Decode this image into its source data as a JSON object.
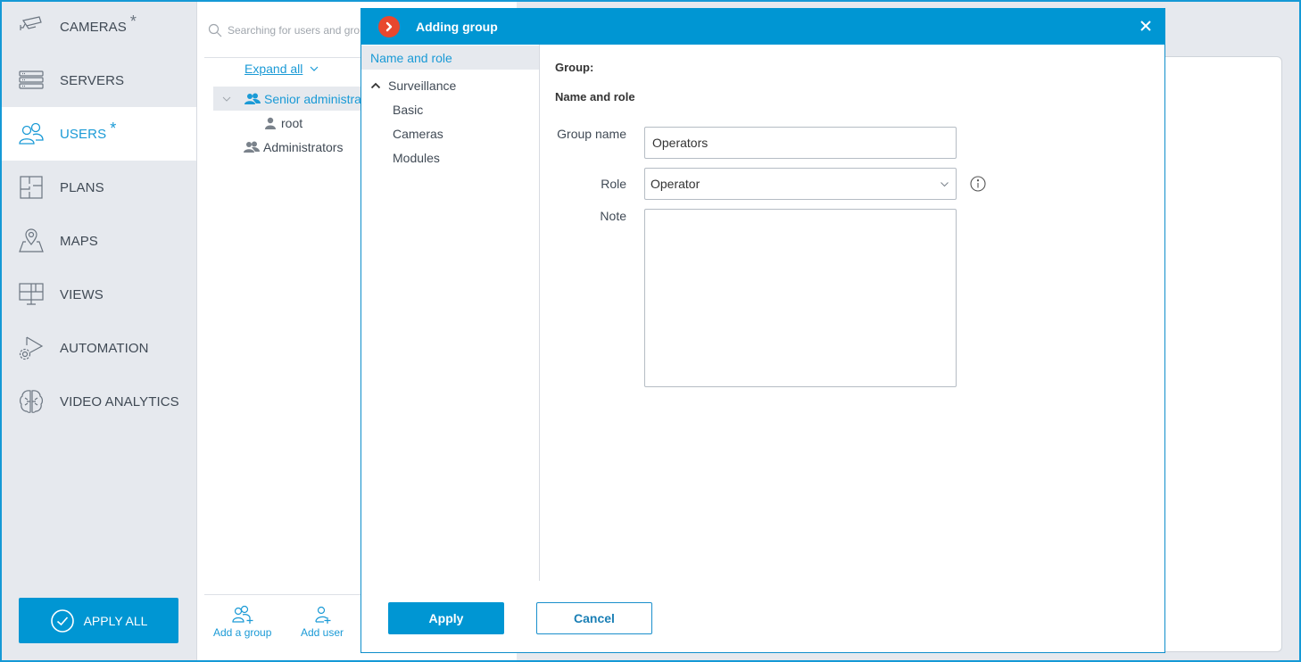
{
  "sidebar": {
    "items": [
      {
        "label": "CAMERAS",
        "icon": "camera-icon",
        "modified": true,
        "active": false
      },
      {
        "label": "SERVERS",
        "icon": "server-icon",
        "modified": false,
        "active": false
      },
      {
        "label": "USERS",
        "icon": "users-icon",
        "modified": true,
        "active": true
      },
      {
        "label": "PLANS",
        "icon": "floor-plan-icon",
        "modified": false,
        "active": false
      },
      {
        "label": "MAPS",
        "icon": "map-pin-icon",
        "modified": false,
        "active": false
      },
      {
        "label": "VIEWS",
        "icon": "monitor-layout-icon",
        "modified": false,
        "active": false
      },
      {
        "label": "AUTOMATION",
        "icon": "automation-icon",
        "modified": false,
        "active": false
      },
      {
        "label": "VIDEO ANALYTICS",
        "icon": "brain-icon",
        "modified": false,
        "active": false
      }
    ],
    "modified_marker": "*",
    "apply_all_label": "APPLY ALL"
  },
  "users_panel": {
    "search_placeholder": "Searching for users and groups",
    "expand_all_label": "Expand all",
    "tree": [
      {
        "label": "Senior administrators",
        "type": "group",
        "expanded": true,
        "selected": true,
        "children": [
          {
            "label": "root",
            "type": "user"
          }
        ]
      },
      {
        "label": "Administrators",
        "type": "group",
        "expanded": false,
        "selected": false
      }
    ],
    "footer": {
      "add_group_label": "Add a group",
      "add_user_label": "Add user"
    }
  },
  "dialog": {
    "title": "Adding group",
    "nav": {
      "items": [
        {
          "label": "Name and role",
          "active": true
        },
        {
          "label": "Surveillance",
          "expandable": true,
          "expanded": true
        },
        {
          "label": "Basic",
          "child": true
        },
        {
          "label": "Cameras",
          "child": true
        },
        {
          "label": "Modules",
          "child": true
        }
      ]
    },
    "main": {
      "group_heading": "Group:",
      "section_heading": "Name and role",
      "fields": {
        "group_name_label": "Group name",
        "group_name_value": "Operators",
        "role_label": "Role",
        "role_value": "Operator",
        "note_label": "Note",
        "note_value": ""
      }
    },
    "buttons": {
      "apply_label": "Apply",
      "cancel_label": "Cancel"
    }
  },
  "colors": {
    "accent": "#0096d3",
    "logo": "#e8472e",
    "sidebar_bg": "#e6e9ee",
    "link": "#1a9ad6"
  }
}
